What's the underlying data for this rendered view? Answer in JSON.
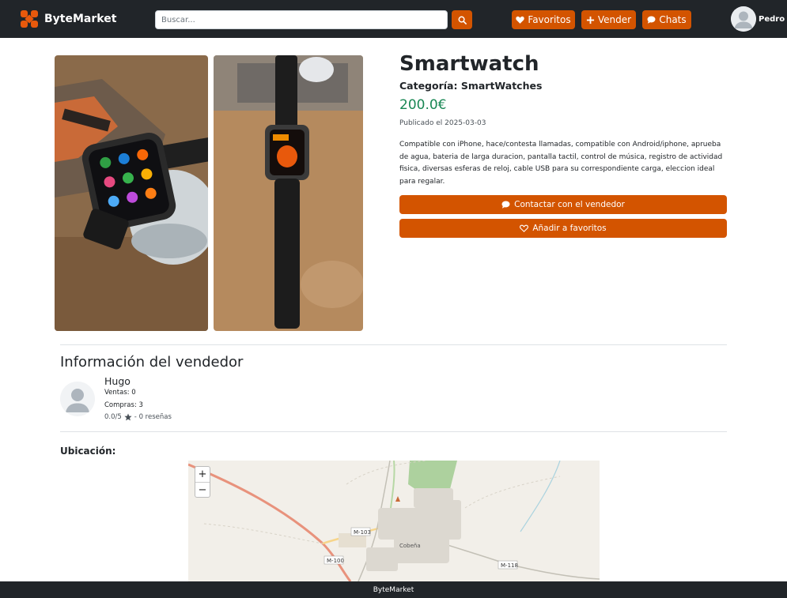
{
  "navbar": {
    "brand": "ByteMarket",
    "search_placeholder": "Buscar...",
    "favorites_label": "Favoritos",
    "sell_label": "Vender",
    "chats_label": "Chats",
    "user_name": "Pedro"
  },
  "product": {
    "title": "Smartwatch",
    "category": "Categoría: SmartWatches",
    "price": "200.0€",
    "published": "Publicado el 2025-03-03",
    "description": "Compatible con iPhone, hace/contesta llamadas, compatible con Android/iphone, aprueba de agua, bateria de larga duracion, pantalla tactil, control de música, registro de actividad fisica, diversas esferas de reloj, cable USB para su correspondiente carga, eleccion ideal para regalar.",
    "contact_label": "Contactar con el vendedor",
    "favorite_label": "Añadir a favoritos"
  },
  "seller": {
    "heading": "Información del vendedor",
    "name": "Hugo",
    "sales": "Ventas: 0",
    "purchases": "Compras: 3",
    "rating_score": "0.0/5",
    "rating_reviews": "- 0 reseñas"
  },
  "location": {
    "label": "Ubicación:",
    "map_labels": {
      "town": "Cobeña",
      "road_m103": "M-103",
      "road_m100": "M-100",
      "road_m118": "M-118"
    },
    "zoom_in": "+",
    "zoom_out": "−"
  },
  "footer": {
    "text": "ByteMarket"
  },
  "colors": {
    "accent": "#d35400",
    "navbar": "#212529",
    "price": "#198754"
  }
}
